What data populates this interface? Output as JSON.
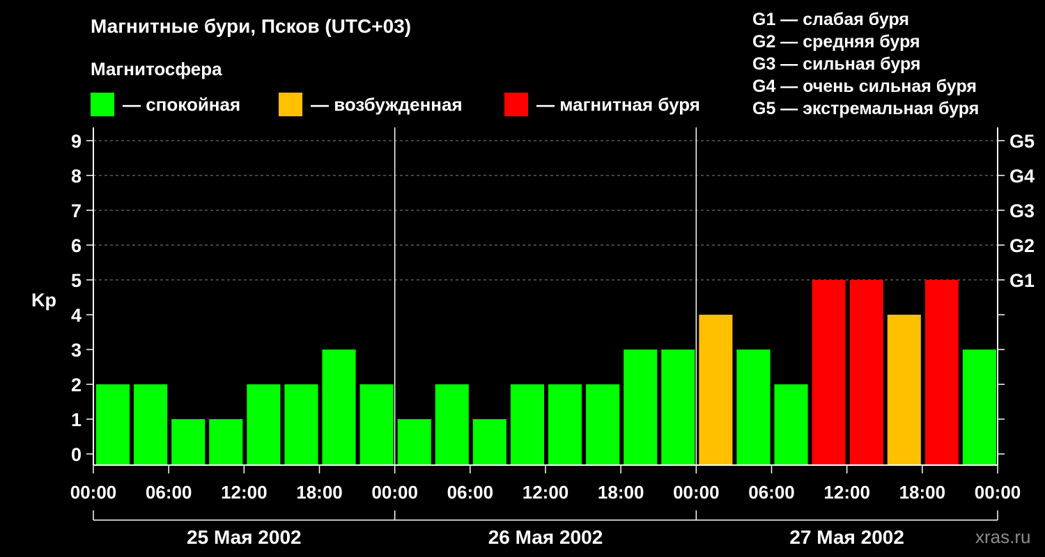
{
  "title": "Магнитные бури, Псков (UTC+03)",
  "subtitle": "Магнитосфера",
  "colors": {
    "background": "#000000",
    "quiet": "#00ff00",
    "unsettled": "#ffc000",
    "storm": "#ff0000",
    "axis": "#ffffff",
    "grid": "#888888",
    "watermark": "#8c8c8c"
  },
  "legend": [
    {
      "label": "— спокойная",
      "color": "#00ff00"
    },
    {
      "label": "— возбужденная",
      "color": "#ffc000"
    },
    {
      "label": "— магнитная буря",
      "color": "#ff0000"
    }
  ],
  "g_legend": [
    "G1 — слабая буря",
    "G2 — средняя буря",
    "G3 — сильная буря",
    "G4 — очень сильная буря",
    "G5 — экстремальная буря"
  ],
  "watermark": "xras.ru",
  "chart_data": {
    "type": "bar",
    "ylabel": "Kp",
    "xlabel": "",
    "ylim": [
      0,
      9
    ],
    "y_ticks": [
      "0",
      "1",
      "2",
      "3",
      "4",
      "5",
      "6",
      "7",
      "8",
      "9"
    ],
    "right_axis_labels": [
      {
        "value": 5,
        "label": "G1"
      },
      {
        "value": 6,
        "label": "G2"
      },
      {
        "value": 7,
        "label": "G3"
      },
      {
        "value": 8,
        "label": "G4"
      },
      {
        "value": 9,
        "label": "G5"
      }
    ],
    "grid": "dashed horizontal at Kp 5–9",
    "x_tick_labels": [
      "00:00",
      "06:00",
      "12:00",
      "18:00",
      "00:00",
      "06:00",
      "12:00",
      "18:00",
      "00:00",
      "06:00",
      "12:00",
      "18:00",
      "00:00"
    ],
    "days": [
      "25 Мая 2002",
      "26 Мая 2002",
      "27 Мая 2002"
    ],
    "interval_hours": 3,
    "values": [
      2,
      2,
      1,
      1,
      2,
      2,
      3,
      2,
      1,
      2,
      1,
      2,
      2,
      2,
      3,
      3,
      4,
      3,
      2,
      5,
      5,
      4,
      5,
      3
    ],
    "levels": [
      "quiet",
      "quiet",
      "quiet",
      "quiet",
      "quiet",
      "quiet",
      "quiet",
      "quiet",
      "quiet",
      "quiet",
      "quiet",
      "quiet",
      "quiet",
      "quiet",
      "quiet",
      "quiet",
      "unsettled",
      "quiet",
      "quiet",
      "storm",
      "storm",
      "unsettled",
      "storm",
      "quiet"
    ]
  }
}
